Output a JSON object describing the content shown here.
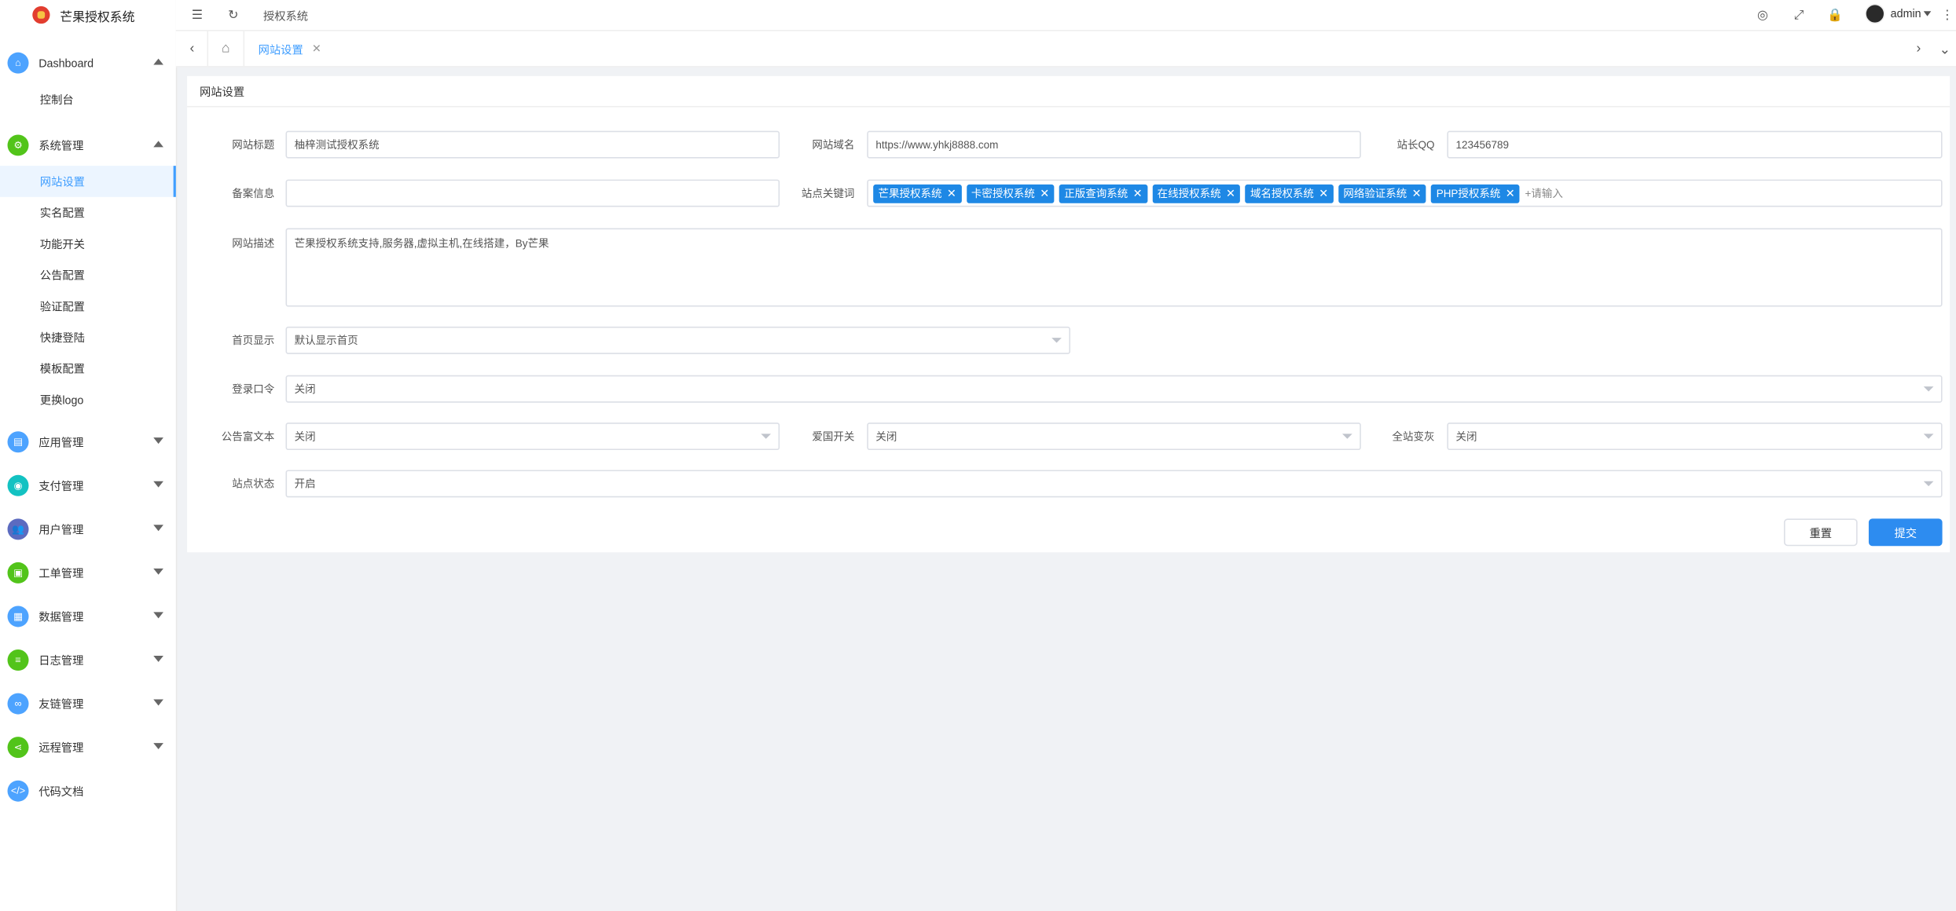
{
  "app": {
    "title": "芒果授权系统"
  },
  "header": {
    "breadcrumb": "授权系统",
    "user_name": "admin"
  },
  "tabs": {
    "active_label": "网站设置"
  },
  "sidebar": {
    "groups": [
      {
        "label": "Dashboard",
        "icon": "dashboard-icon",
        "color": "#4da3ff",
        "expanded": true,
        "children": [
          "控制台"
        ]
      },
      {
        "label": "系统管理",
        "icon": "settings-icon",
        "color": "#52c41a",
        "expanded": true,
        "children": [
          "网站设置",
          "实名配置",
          "功能开关",
          "公告配置",
          "验证配置",
          "快捷登陆",
          "模板配置",
          "更换logo"
        ]
      },
      {
        "label": "应用管理",
        "icon": "app-icon",
        "color": "#4da3ff"
      },
      {
        "label": "支付管理",
        "icon": "payment-icon",
        "color": "#13c2c2"
      },
      {
        "label": "用户管理",
        "icon": "users-icon",
        "color": "#5c6bc0"
      },
      {
        "label": "工单管理",
        "icon": "ticket-icon",
        "color": "#52c41a"
      },
      {
        "label": "数据管理",
        "icon": "data-icon",
        "color": "#4da3ff"
      },
      {
        "label": "日志管理",
        "icon": "log-icon",
        "color": "#52c41a"
      },
      {
        "label": "友链管理",
        "icon": "link-icon",
        "color": "#4da3ff"
      },
      {
        "label": "远程管理",
        "icon": "share-icon",
        "color": "#52c41a"
      },
      {
        "label": "代码文档",
        "icon": "code-icon",
        "color": "#4da3ff"
      }
    ],
    "active_item": "网站设置"
  },
  "form": {
    "card_title": "网站设置",
    "site_title": {
      "label": "网站标题",
      "value": "柚梓测试授权系统"
    },
    "site_domain": {
      "label": "网站域名",
      "value": "https://www.yhkj8888.com"
    },
    "admin_qq": {
      "label": "站长QQ",
      "value": "123456789"
    },
    "icp": {
      "label": "备案信息",
      "value": ""
    },
    "keywords": {
      "label": "站点关键词",
      "tags": [
        "芒果授权系统",
        "卡密授权系统",
        "正版查询系统",
        "在线授权系统",
        "域名授权系统",
        "网络验证系统",
        "PHP授权系统"
      ],
      "placeholder": "+请输入"
    },
    "description": {
      "label": "网站描述",
      "value": "芒果授权系统支持,服务器,虚拟主机,在线搭建，By芒果"
    },
    "homepage": {
      "label": "首页显示",
      "value": "默认显示首页"
    },
    "login_token": {
      "label": "登录口令",
      "value": "关闭"
    },
    "notice_richtext": {
      "label": "公告富文本",
      "value": "关闭"
    },
    "patriot_switch": {
      "label": "爱国开关",
      "value": "关闭"
    },
    "grayscale": {
      "label": "全站变灰",
      "value": "关闭"
    },
    "site_status": {
      "label": "站点状态",
      "value": "开启"
    },
    "reset_label": "重置",
    "submit_label": "提交"
  }
}
